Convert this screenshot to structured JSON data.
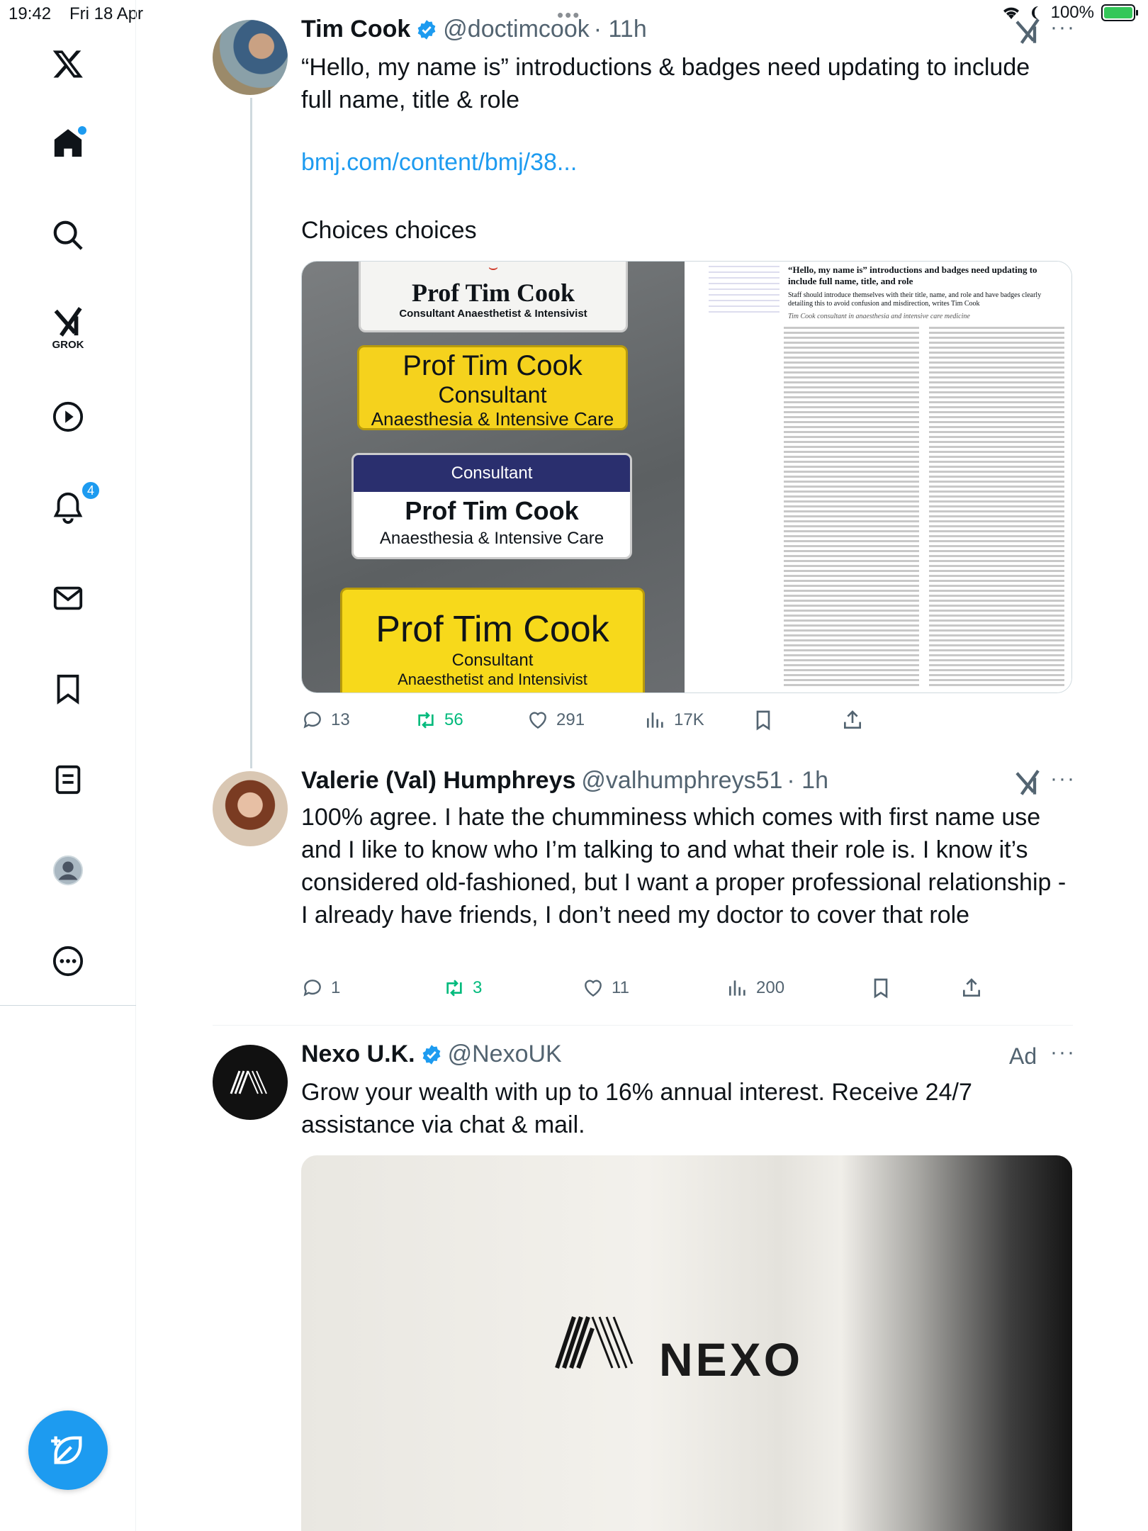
{
  "status_bar": {
    "time": "19:42",
    "date": "Fri 18 Apr",
    "battery": "100%"
  },
  "sidebar": {
    "grok_label": "GROK",
    "notifications_count": "4"
  },
  "tweets": [
    {
      "name": "Tim Cook",
      "handle": "@doctimcook",
      "time": "· 11h",
      "text": "“Hello, my name is” introductions & badges need updating to include full name, title & role",
      "link": "bmj.com/content/bmj/38...",
      "text2": "Choices choices",
      "replies": "13",
      "reposts": "56",
      "likes": "291",
      "views": "17K",
      "media": {
        "badge1_name": "Prof Tim Cook",
        "badge1_role": "Consultant Anaesthetist & Intensivist",
        "badge2_name": "Prof  Tim  Cook",
        "badge2_role": "Consultant",
        "badge2_dept": "Anaesthesia  &  Intensive  Care",
        "badge3_title": "Consultant",
        "badge3_name": "Prof Tim Cook",
        "badge3_dept": "Anaesthesia & Intensive Care",
        "badge4_name": "Prof Tim Cook",
        "badge4_role": "Consultant",
        "badge4_dept": "Anaesthetist and Intensivist",
        "paper_title": "“Hello, my name is” introductions and badges need updating to include full name, title, and role",
        "paper_subtitle": "Staff should introduce themselves with their title, name, and role and have badges clearly detailing this to avoid confusion and misdirection, writes Tim Cook",
        "paper_byline": "Tim Cook consultant in anaesthesia and intensive care medicine"
      }
    },
    {
      "name": "Valerie (Val) Humphreys",
      "handle": "@valhumphreys51",
      "time": "· 1h",
      "text": "100% agree. I hate the chumminess which comes with first name use and I like to know who I’m talking to and what their role is. I know it’s considered old-fashioned, but I want a proper professional relationship - I already have friends, I don’t need my doctor to cover that role",
      "replies": "1",
      "reposts": "3",
      "likes": "11",
      "views": "200"
    },
    {
      "name": "Nexo U.K.",
      "handle": "@NexoUK",
      "ad_label": "Ad",
      "text": "Grow your wealth with up to 16% annual interest. Receive 24/7 assistance via chat & mail.",
      "brand": "NEXO"
    }
  ],
  "colors": {
    "accent": "#1d9bf0",
    "repost": "#00ba7c",
    "muted": "#536471"
  }
}
